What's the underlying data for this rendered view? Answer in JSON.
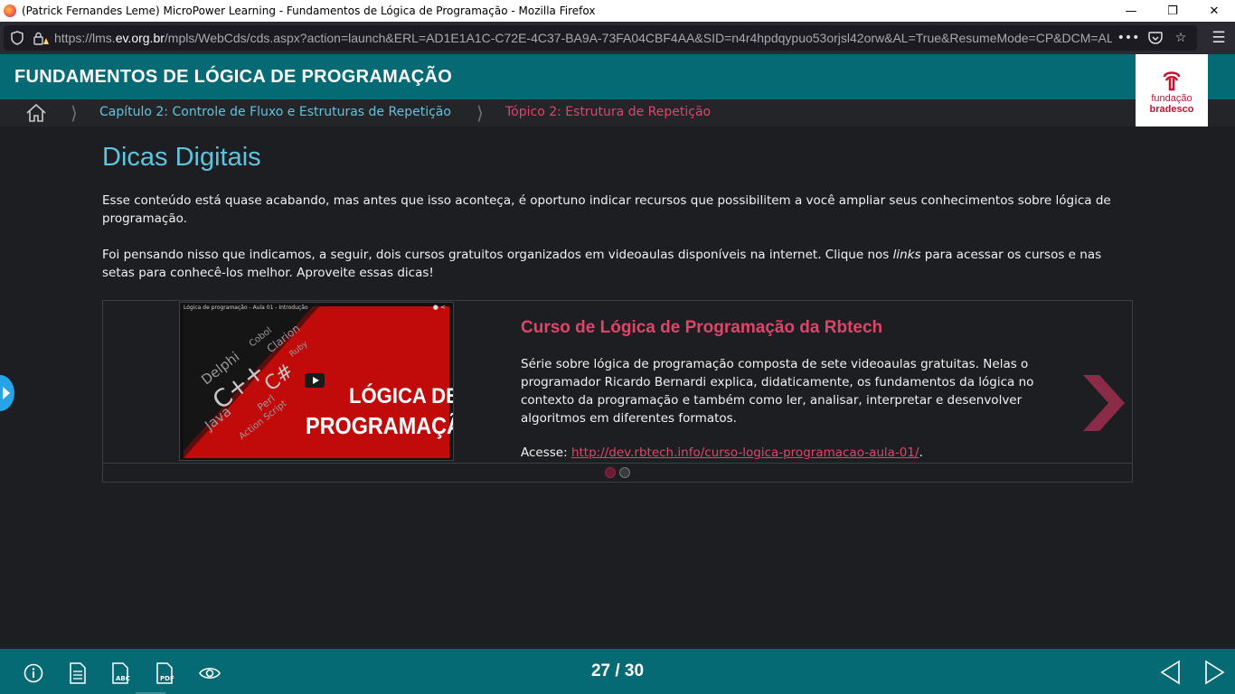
{
  "browser": {
    "window_title": "(Patrick Fernandes Leme) MicroPower Learning - Fundamentos de Lógica de Programação - Mozilla Firefox",
    "url_prefix": "https://lms.",
    "url_domain": "ev.org.br",
    "url_rest": "/mpls/WebCds/cds.aspx?action=launch&ERL=AD1E1A1C-C72E-4C37-BA9A-73FA04CBF4AA&SID=n4r4hpdqypuo53orjsl42orw&AL=True&ResumeMode=CP&DCM=ALL&",
    "icons": {
      "shield": "shield-icon",
      "lock_warning": "lock-warning-icon",
      "more": "more-dots-icon",
      "pocket": "pocket-icon",
      "bookmark": "star-icon",
      "menu": "hamburger-menu-icon"
    }
  },
  "header": {
    "title": "FUNDAMENTOS DE LÓGICA DE PROGRAMAÇÃO",
    "logo_line1": "fundação",
    "logo_line2": "bradesco"
  },
  "breadcrumb": {
    "chapter": "Capítulo 2: Controle de Fluxo e Estruturas de Repetição",
    "topic": "Tópico 2: Estrutura de Repetição"
  },
  "content": {
    "heading": "Dicas Digitais",
    "paragraph1": "Esse conteúdo está quase acabando, mas antes que isso aconteça, é oportuno indicar recursos que possibilitem a você ampliar seus conhecimentos sobre lógica de programação.",
    "paragraph2_before": "Foi pensando nisso que indicamos, a seguir, dois cursos gratuitos organizados em videoaulas disponíveis na internet. Clique nos ",
    "paragraph2_italic": "links",
    "paragraph2_after": " para acessar os cursos e nas setas para conhecê-los melhor. Aproveite essas dicas!"
  },
  "carousel": {
    "video": {
      "top_caption": "Lógica de programação - Aula 01 - Introdução",
      "line1": "LÓGICA DE",
      "line2": "PROGRAMAÇÃO",
      "languages": [
        "Java",
        "C++",
        "Delphi",
        "C#",
        "Cobol",
        "Clarion",
        "Perl",
        "Action Script",
        "Ruby"
      ]
    },
    "course_title": "Curso de Lógica de Programação da Rbtech",
    "course_description": "Série sobre lógica de programação composta de sete videoaulas gratuitas. Nelas o programador Ricardo Bernardi explica, didaticamente, os fundamentos da lógica no contexto da programação e também como ler, analisar, interpretar e desenvolver algoritmos em diferentes formatos.",
    "access_label": "Acesse: ",
    "access_link": "http://dev.rbtech.info/curso-logica-programacao-aula-01/",
    "access_suffix": ".",
    "slides": 2,
    "active_slide": 1,
    "colors": {
      "accent": "#e0446b",
      "arrow": "#8b2b48"
    }
  },
  "footer": {
    "current_page": 27,
    "total_pages": 30,
    "page_label": "27 / 30",
    "icons": [
      "info-icon",
      "document-icon",
      "glossary-abc-icon",
      "pdf-icon",
      "eye-icon"
    ]
  },
  "theme": {
    "teal": "#056a73",
    "background": "#1d1e22",
    "cyan_text": "#5fc4df",
    "pink_text": "#e0446b"
  }
}
